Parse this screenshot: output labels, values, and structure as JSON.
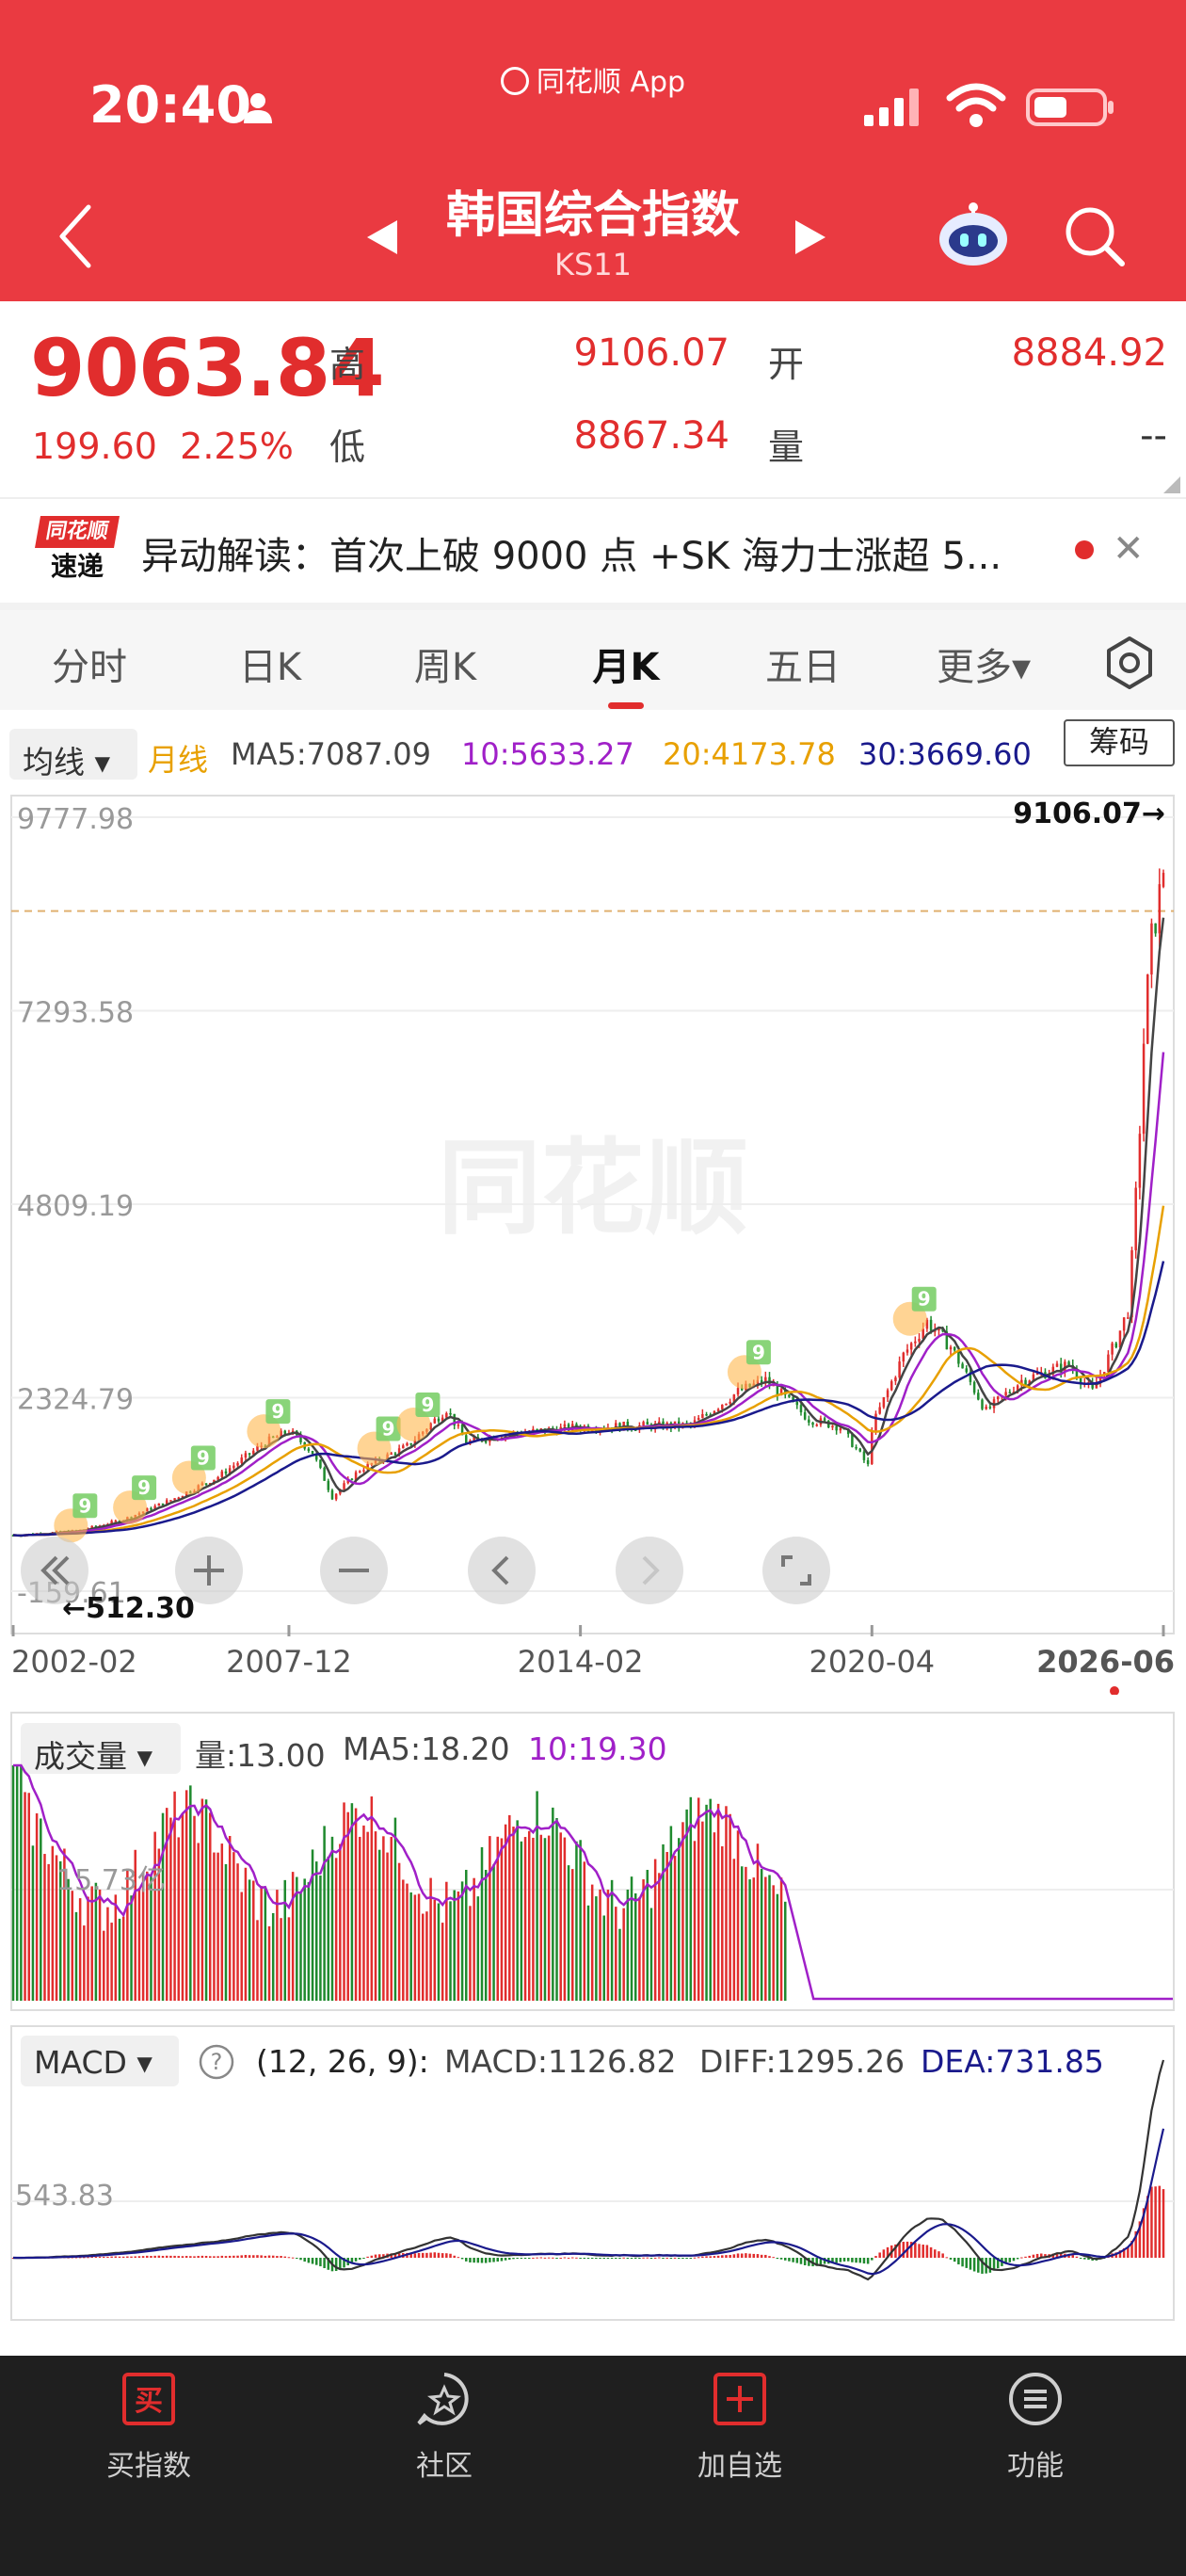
{
  "header": {
    "time": "20:40",
    "app_name": "同花顺 App",
    "title": "韩国综合指数",
    "subtitle": "KS11"
  },
  "quote": {
    "price": "9063.84",
    "change": "199.60",
    "change_pct": "2.25%",
    "high_label": "高",
    "high": "9106.07",
    "open_label": "开",
    "open": "8884.92",
    "low_label": "低",
    "low": "8867.34",
    "volume_label": "量",
    "volume": "--"
  },
  "news": {
    "logo_top": "同花顺",
    "logo_bottom": "速递",
    "text": "异动解读：首次上破 9000 点 +SK 海力士涨超 5..."
  },
  "tabs": [
    {
      "label": "分时"
    },
    {
      "label": "日K"
    },
    {
      "label": "周K"
    },
    {
      "label": "月K",
      "active": true
    },
    {
      "label": "五日"
    },
    {
      "label": "更多▾"
    }
  ],
  "ma_legend": {
    "selector": "均线",
    "period": "月线",
    "ma5": "MA5:7087.09",
    "ma10": "10:5633.27",
    "ma20": "20:4173.78",
    "ma30": "30:3669.60",
    "chip_button": "筹码"
  },
  "colors": {
    "brand": "#ea3a41",
    "up": "#e12d2d",
    "down": "#1f8a2e",
    "ma5": "#444444",
    "ma10": "#a020c8",
    "ma20": "#e8a000",
    "ma30": "#1a1a8c"
  },
  "chart_data": {
    "type": "candlestick",
    "price_axis": [
      "9777.98",
      "7293.58",
      "4809.19",
      "2324.79",
      "-159.61"
    ],
    "ylim": [
      -159.61,
      9777.98
    ],
    "max_marker": "9106.07",
    "min_marker": "512.30",
    "x_ticks": [
      "2002-02",
      "2007-12",
      "2014-02",
      "2020-04",
      "2026-06"
    ],
    "close_series": [
      {
        "date": "2002-02",
        "close": 560
      },
      {
        "date": "2003-06",
        "close": 610
      },
      {
        "date": "2004-06",
        "close": 760
      },
      {
        "date": "2005-06",
        "close": 1010
      },
      {
        "date": "2006-06",
        "close": 1310
      },
      {
        "date": "2007-06",
        "close": 1750
      },
      {
        "date": "2007-12",
        "close": 1900
      },
      {
        "date": "2008-06",
        "close": 1620
      },
      {
        "date": "2008-11",
        "close": 1050
      },
      {
        "date": "2009-06",
        "close": 1400
      },
      {
        "date": "2010-06",
        "close": 1700
      },
      {
        "date": "2011-04",
        "close": 2180
      },
      {
        "date": "2011-09",
        "close": 1750
      },
      {
        "date": "2012-06",
        "close": 1850
      },
      {
        "date": "2014-02",
        "close": 1950
      },
      {
        "date": "2016-06",
        "close": 1970
      },
      {
        "date": "2017-06",
        "close": 2400
      },
      {
        "date": "2018-01",
        "close": 2550
      },
      {
        "date": "2018-12",
        "close": 2050
      },
      {
        "date": "2019-08",
        "close": 1950
      },
      {
        "date": "2020-03",
        "close": 1450
      },
      {
        "date": "2020-04",
        "close": 1950
      },
      {
        "date": "2020-12",
        "close": 2870
      },
      {
        "date": "2021-06",
        "close": 3300
      },
      {
        "date": "2021-12",
        "close": 2980
      },
      {
        "date": "2022-09",
        "close": 2150
      },
      {
        "date": "2023-06",
        "close": 2550
      },
      {
        "date": "2024-06",
        "close": 2750
      },
      {
        "date": "2024-12",
        "close": 2400
      },
      {
        "date": "2025-06",
        "close": 3050
      },
      {
        "date": "2025-09",
        "close": 3450
      },
      {
        "date": "2025-10",
        "close": 4100
      },
      {
        "date": "2025-11",
        "close": 4900
      },
      {
        "date": "2025-12",
        "close": 5800
      },
      {
        "date": "2026-01",
        "close": 6900
      },
      {
        "date": "2026-02",
        "close": 7600
      },
      {
        "date": "2026-03",
        "close": 8200
      },
      {
        "date": "2026-06",
        "close": 9063.84
      }
    ]
  },
  "volume_panel": {
    "selector": "成交量",
    "vol": "量:13.00",
    "ma5": "MA5:18.20",
    "ma10": "10:19.30",
    "axis_label": "15.73亿"
  },
  "macd_panel": {
    "selector": "MACD",
    "help": "?",
    "params": "(12, 26, 9):",
    "macd": "MACD:1126.82",
    "diff": "DIFF:1295.26",
    "dea": "DEA:731.85",
    "axis_label": "543.83"
  },
  "watermark": "同花顺",
  "bottom_nav": [
    {
      "label": "买指数",
      "icon": "buy-icon"
    },
    {
      "label": "社区",
      "icon": "community-icon"
    },
    {
      "label": "加自选",
      "icon": "add-watchlist-icon"
    },
    {
      "label": "功能",
      "icon": "menu-icon"
    }
  ]
}
